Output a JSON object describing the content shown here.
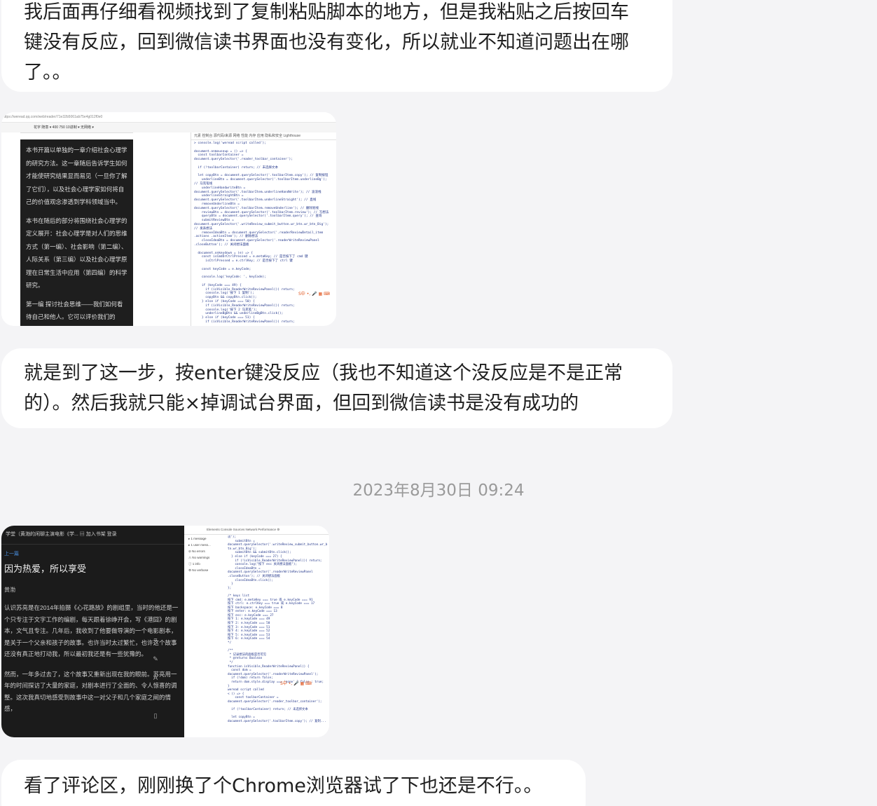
{
  "messages": [
    {
      "lines": [
        "我后面再仔细看视频找到了复制粘贴脚本的地方，但是我粘贴之后按回车",
        "键没有反应，回到微信读书界面也没有变化，所以就业不知道问题出在哪",
        "了。。"
      ]
    },
    {
      "lines": [
        "就是到了这一步，按enter键没反应（我也不知道这个没反应是不是正常",
        "的）。然后我就只能×掉调试台界面，但回到微信读书是没有成功的"
      ]
    },
    {
      "lines": [
        "看了评论区，刚刚换了个Chrome浏览器试了下也还是不行。。"
      ]
    }
  ],
  "timestamp": "2023年8月30日 09:24",
  "screenshot1": {
    "url": "https://weread.qq.com/web/reader/71e32b5061ab75e4g012f0e0",
    "toolbar": "花字 随意 ▾   400   750   10进制 ▾   无网络 ▾",
    "devtabs": "元素   控制台   源代码/来源   网络   性能   内存   应用   隐私和安全   Lighthouse",
    "panel_paragraphs": [
      "本书开篇以单独的一章介绍社会心理学的研究方法。这一章随后告诉学生如何才能使研究结果显而易见（一旦你了解了它们），以及社会心理学家如何将自己的价值观念渗透到学科领域当中。",
      "本书在随后的部分将围绕社会心理学的定义展开：社会心理学是对人们的思维方式（第一编）、社会影响（第二编）、人际关系（第三编）以及社会心理学原理在日常生活中应用（第四编）的科学研究。",
      "第一编   探讨社会思维——我们如何看待自己和他人。它可以评价我们的"
    ],
    "code": "> console.log('weread script called');\n\ndocument.onmouseup = () => {\n  const toolbarContainer =\ndocument.querySelector('.reader_toolbar_container');\n\n  if (!toolbarContainer) return; // 未选择文本\n\n  let copyBtn = document.querySelector('.toolbarItem.copy'); // 复制按钮\n    underlineBtn = document.querySelector('.toolbarItem.underlineBg');\n// 马克笔线\n    underlineHandwriteBtn =\ndocument.querySelector('.toolbarItem.underlineHandWrite'); // 波浪线\n    underlineStraightBtn =\ndocument.querySelector('.toolbarItem.underlineStraight'); // 直线\n    removeUnderlineBtn =\ndocument.querySelector('.toolbarItem.removeUnderline'); // 删除划线\n    reviewBtn = document.querySelector('.toolbarItem.review'); // 写想法\n    queryBtn = document.querySelector('.toolbarItem.query'); // 查询\n    submitReviewBtn =\ndocument.querySelector('.writeReview_submit_button.wr_btn.wr_btn_Big');\n// 发表想法\n    removeIdeaBtn = document.querySelector('.readerReviewDetail_item\n.actions .actionItem'); // 删除想法\n    closeIdeaBtn = document.querySelector('.readerWriteReviewPanel\n.closeButton'); // 关闭想法面板\n\n  document.onkeydown = (e) => {\n    const isCmdOrCtrlPressed = e.metaKey; // 是否按下了 cmd 键\n      isCtrlPressed = e.ctrlKey; // 是否按下了 ctrl 键\n\n    const keyCode = e.keyCode;\n\n    console.log('keyCode: ', keyCode);\n\n    if (keyCode === 49) {\n      if (isVisible_ReaderWriteReviewPanel()) return;\n      console.log('按下 1 复制');\n      copyBtn && copyBtn.click();\n    } else if (keyCode === 50) {\n      if (isVisible_ReaderWriteReviewPanel()) return;\n      console.log('按下 2 马克笔');\n      underlineBgBtn && underlineBgBtn.click();\n    } else if (keyCode === 51) {\n      if (isVisible_ReaderWriteReviewPanel()) return;",
    "ime": "S中 •, 🎤 ▦ ⌨"
  },
  "screenshot2": {
    "header": "学堂（黄渤的闲聊主演电影《学...      ▤ 加入书架    登录",
    "prev": "上一篇",
    "title": "因为热爱，所以享受",
    "author": "黄渤",
    "paragraphs": [
      "认识苏亮是在2014年拍摄《心花路放》的剧组里，当时的他还是一个只专注于文字工作的编剧，每天跟着徐峥开会，写《港囧》的剧本，文气且专注。几年后，我收到了他要做导演的一个电影剧本，是关于一个父亲和孩子的故事。也许当时太过繁忙，也许这个故事还没有真正地打动我，所以最初我还是有一些犹豫的。",
      "然而，一年多过去了，这个故事又重新出现在我的眼前。苏亮用一年的时间探访了大量的家庭，对剧本进行了全面的、令人惊喜的调整。这次我真切地感受到故事中这一对父子和几个家庭之间的情感，"
    ],
    "devtabs": "Elements   Console   Sources   Network   Performance   ⚙",
    "side_items": [
      "▸ 1 message",
      "▸ 1 user mess...",
      "⊘ No errors",
      "⚠ No warnings",
      "ⓘ 1 info",
      "⚙ No verbose"
    ],
    "code": "功\");\n    submitBtn =\ndocument.querySelector('.writeReview_submit_button.wr_b\ntn.wr_btn_Big');\n    submitBtn && submitBtn.click();\n  } else if (keyCode === 27) {\n    if (!isVisible_ReaderWriteReviewPanel()) return;\n    console.log(\"按下 esc 关闭想法面板\");\n    closeIdeaBtn =\ndocument.querySelector('.readerWriteReviewPanel\n.closeButton'); // 关闭想法面板\n    closeIdeaBtn.click();\n  }\n};\n\n/* keys list\n按下 cmd: e.metaKey === true 或 e.keyCode === 91\n按下 ctrl: e.ctrlKey === true 或 e.keyCode === 17\n按下 backspace: e.keyCode === 8\n按下 enter: e.keyCode === 13\n按下 esc: e.keyCode === 27\n按下 1: e.keyCode === 49\n按下 2: e.keyCode === 50\n按下 3: e.keyCode === 51\n按下 4: e.keyCode === 52\n按下 5: e.keyCode === 53\n按下 6: e.keyCode === 54\n*/\n\n/**\n * 记录想法的面板是否可见\n * @returns Boolean\n */\nfunction isVisible_ReaderWriteReviewPanel() {\n  const dom =\ndocument.querySelector('.readerWriteReviewPanel');\n  if (!dom) return false;\n  return dom.style.display === 'none' ? false : true;\n}\nweread script called\n< () => {\n    const toolbarContainer =\ndocument.querySelector('.reader_toolbar_container');\n\n  if (!toolbarContainer) return; // 未选择文本\n\n  let copyBtn =\ndocument.querySelector('.toolbarItem.copy'); // 复制...",
    "ime": "S中 •, 🎤 ▦ ⌨"
  }
}
